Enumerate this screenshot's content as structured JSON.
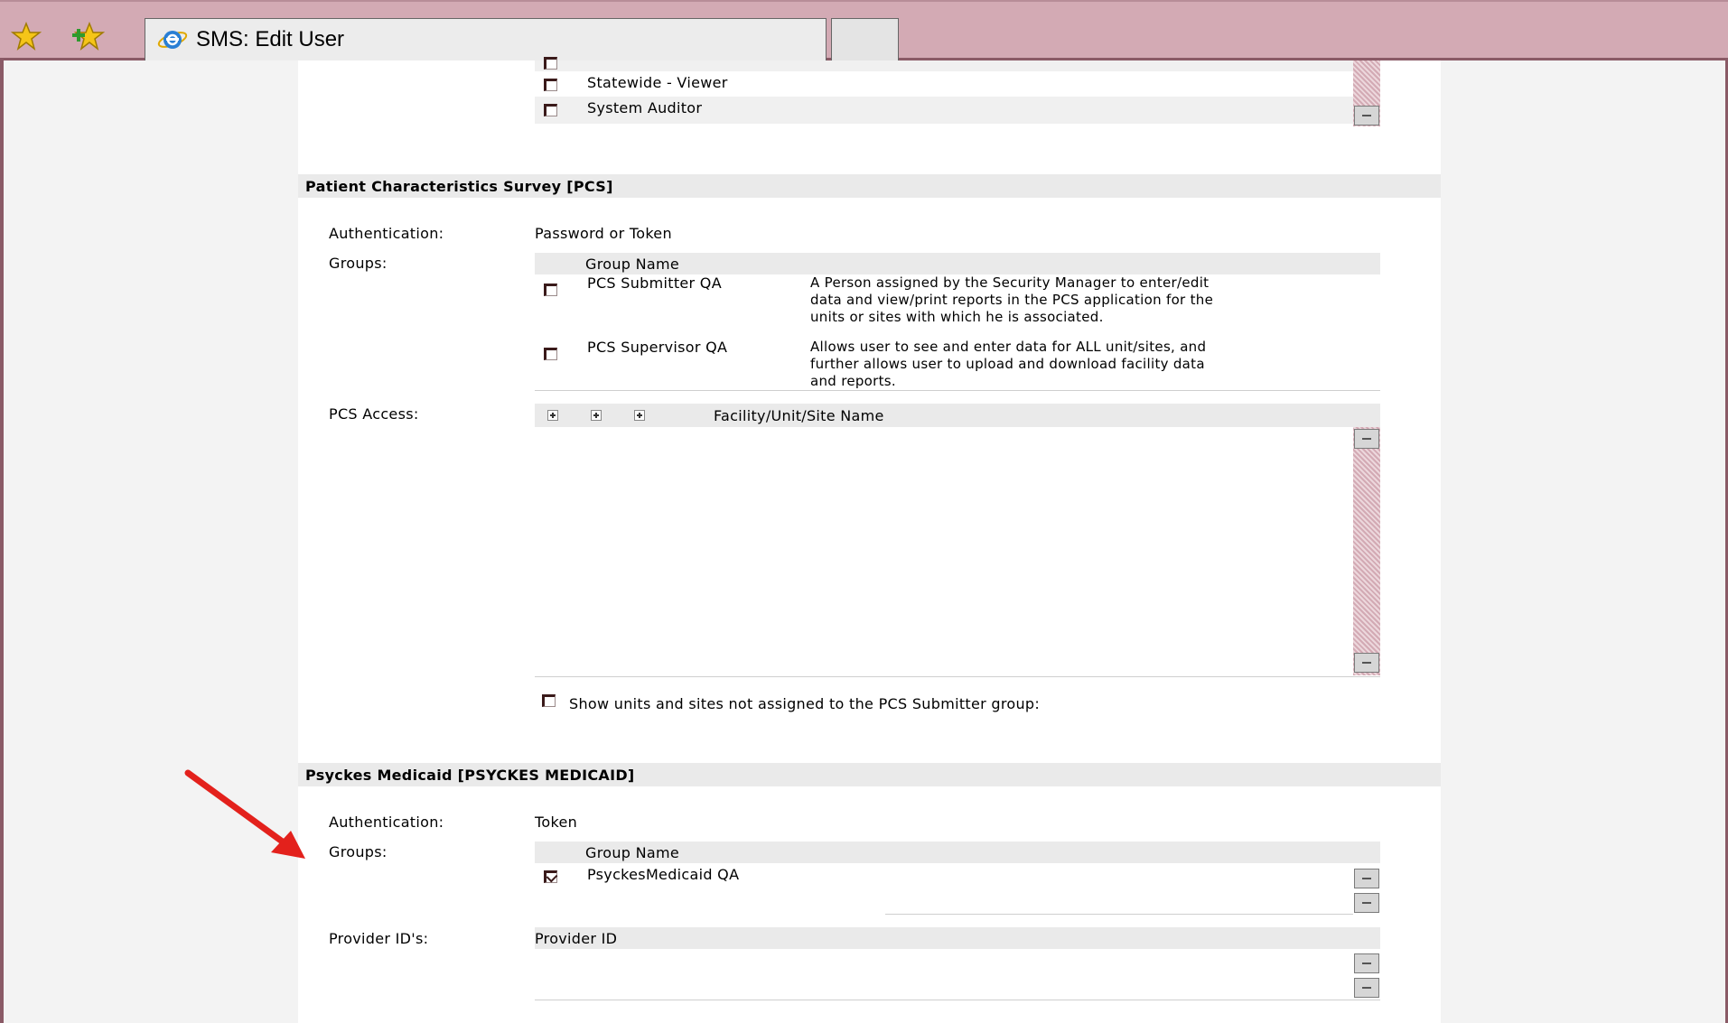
{
  "browser": {
    "tab_title": "SMS: Edit User",
    "icons": [
      "favorites-star-icon",
      "add-favorites-icon",
      "ie-logo-icon"
    ]
  },
  "top_list": {
    "items": [
      {
        "label": "Statewide - Viewer",
        "checked": false
      },
      {
        "label": "System Auditor",
        "checked": false
      }
    ]
  },
  "pcs": {
    "heading": "Patient Characteristics Survey [PCS]",
    "auth_label": "Authentication:",
    "auth_value": "Password or Token",
    "groups_label": "Groups:",
    "group_col_header": "Group Name",
    "groups": [
      {
        "name": "PCS Submitter QA",
        "checked": false,
        "desc": [
          "A Person assigned by the Security  Manager to enter/edit",
          "data and view/print reports in the PCS application for the",
          "units or sites with which he is associated."
        ]
      },
      {
        "name": "PCS Supervisor QA",
        "checked": false,
        "desc": [
          "Allows user to see and enter data for ALL unit/sites, and",
          "further allows user to upload and download facility data",
          "and reports."
        ]
      }
    ],
    "access_label": "PCS Access:",
    "access_col_header": "Facility/Unit/Site Name",
    "show_units_label": "Show units and sites not assigned to the PCS Submitter group:",
    "show_units_checked": false
  },
  "psyckes": {
    "heading": "Psyckes Medicaid [PSYCKES MEDICAID]",
    "auth_label": "Authentication:",
    "auth_value": "Token",
    "groups_label": "Groups:",
    "group_col_header": "Group Name",
    "groups": [
      {
        "name": "PsyckesMedicaid QA",
        "checked": true
      }
    ],
    "provider_label": "Provider ID's:",
    "provider_col_header": "Provider ID"
  },
  "colors": {
    "tabbar": "#d3aab4",
    "annotation_arrow": "#e3211c"
  }
}
